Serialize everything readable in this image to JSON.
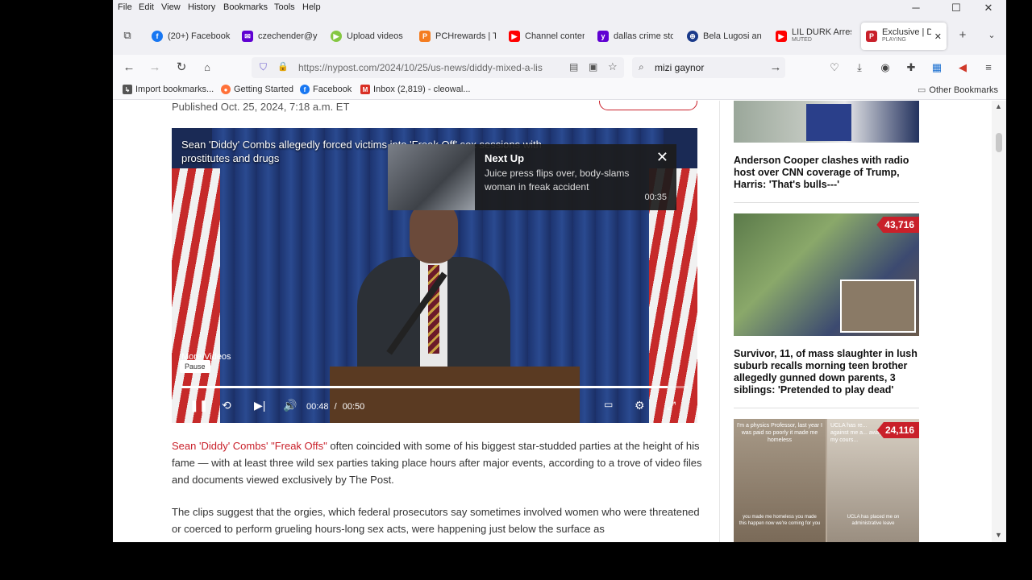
{
  "menu": [
    "File",
    "Edit",
    "View",
    "History",
    "Bookmarks",
    "Tools",
    "Help"
  ],
  "tabs": [
    {
      "label": "(20+) Facebook",
      "icon": "facebook-icon",
      "color": "#1877f2"
    },
    {
      "label": "czechender@y",
      "icon": "yahoo-mail-icon",
      "color": "#6001d2"
    },
    {
      "label": "Upload videos",
      "icon": "rumble-icon",
      "color": "#85c742"
    },
    {
      "label": "PCHrewards | T",
      "icon": "pch-icon",
      "color": "#f47c20"
    },
    {
      "label": "Channel conter",
      "icon": "youtube-icon",
      "color": "#ff0000"
    },
    {
      "label": "dallas crime sto",
      "icon": "yahoo-icon",
      "color": "#6001d2"
    },
    {
      "label": "Bela Lugosi an",
      "icon": "web-icon",
      "color": "#1a3a8a"
    },
    {
      "label": "LIL DURK Arrest",
      "sub": "MUTED",
      "icon": "youtube-icon",
      "color": "#ff0000"
    },
    {
      "label": "Exclusive | Di",
      "sub": "PLAYING",
      "icon": "nypost-icon",
      "color": "#c9202a"
    }
  ],
  "nav": {
    "url": "https://nypost.com/2024/10/25/us-news/diddy-mixed-a-lis",
    "search_query": "mizi gaynor"
  },
  "bookmarks": [
    {
      "label": "Import bookmarks...",
      "icon": "import-icon",
      "color": "#555555"
    },
    {
      "label": "Getting Started",
      "icon": "firefox-icon",
      "color": "#ff7139"
    },
    {
      "label": "Facebook",
      "icon": "facebook-icon",
      "color": "#1877f2"
    },
    {
      "label": "Inbox (2,819) - cleowal...",
      "icon": "gmail-icon",
      "color": "#d93025"
    }
  ],
  "other_bookmarks": "Other Bookmarks",
  "article": {
    "published": "Published Oct. 25, 2024, 7:18 a.m. ET",
    "video_title": "Sean 'Diddy' Combs allegedly forced victims into 'Freak Off' sex sessions with prostitutes and drugs",
    "next_up_label": "Next Up",
    "next_up_title": "Juice press flips over, body-slams woman in freak accident",
    "next_up_duration": "00:35",
    "more_videos": "More Videos",
    "pause_tooltip": "Pause",
    "time_current": "00:48",
    "time_separator": "/",
    "time_total": "00:50",
    "progress": 0.96,
    "para1_link1": "Sean 'Diddy' Combs'",
    "para1_link2": "\"Freak Offs\"",
    "para1_rest": " often coincided with some of his biggest star-studded parties at the height of his fame — with at least three wild sex parties taking place hours after major events, according to a trove of video files and documents viewed exclusively by The Post.",
    "para2": "The clips suggest that the orgies, which federal prosecutors say sometimes involved women who were threatened or coerced to perform grueling hours-long sex acts, were happening just below the surface as"
  },
  "sidebar": [
    {
      "caption": "Anderson Cooper clashes with radio host over CNN coverage of Trump, Harris: 'That's bulls---'"
    },
    {
      "caption": "Survivor, 11, of mass slaughter in lush suburb recalls morning teen brother allegedly gunned down parents, 3 siblings: 'Pretended to play dead'",
      "badge": "43,716"
    },
    {
      "badge": "24,116",
      "overlay_left": "I'm a physics Professor, last year I was paid so poorly it made me homeless",
      "overlay_left_bottom": "you made me homeless you made this happen now we're coming for you",
      "overlay_right": "UCLA has re... against me a... away my cours...",
      "overlay_right_bottom": "UCLA has placed me on administrative leave"
    }
  ]
}
